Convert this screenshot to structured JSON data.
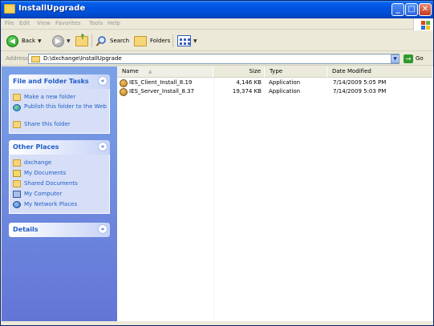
{
  "window": {
    "title": "InstallUpgrade",
    "controls": {
      "minimize": "_",
      "maximize": "□",
      "close": "✕"
    }
  },
  "menu": [
    "File",
    "Edit",
    "View",
    "Favorites",
    "Tools",
    "Help"
  ],
  "toolbar": {
    "back_label": "Back",
    "search_label": "Search",
    "folders_label": "Folders"
  },
  "address": {
    "label": "Address",
    "path": "D:\\dxchange\\InstallUpgrade",
    "go_label": "Go"
  },
  "task_pane": {
    "file_folder_tasks": {
      "title": "File and Folder Tasks",
      "items": [
        {
          "label": "Make a new folder",
          "icon": "new-folder-icon"
        },
        {
          "label": "Publish this folder to the Web",
          "icon": "globe-icon"
        },
        {
          "label": "Share this folder",
          "icon": "share-folder-icon"
        }
      ]
    },
    "other_places": {
      "title": "Other Places",
      "items": [
        {
          "label": "dxchange",
          "icon": "folder-icon"
        },
        {
          "label": "My Documents",
          "icon": "documents-icon"
        },
        {
          "label": "Shared Documents",
          "icon": "folder-icon"
        },
        {
          "label": "My Computer",
          "icon": "computer-icon"
        },
        {
          "label": "My Network Places",
          "icon": "network-icon"
        }
      ]
    },
    "details": {
      "title": "Details"
    }
  },
  "file_list": {
    "columns": [
      "Name",
      "Size",
      "Type",
      "Date Modified"
    ],
    "sort_indicator": "▲",
    "rows": [
      {
        "name": "IES_Client_Install_8.19",
        "size": "4,146 KB",
        "type": "Application",
        "date": "7/14/2009 5:05 PM"
      },
      {
        "name": "IES_Server_Install_8.37",
        "size": "19,374 KB",
        "type": "Application",
        "date": "7/14/2009 5:03 PM"
      }
    ]
  },
  "colors": {
    "titlebar": "#0054e3",
    "taskpane_top": "#7ba2e7",
    "taskpane_bottom": "#6375d6",
    "task_link": "#215dc6"
  }
}
